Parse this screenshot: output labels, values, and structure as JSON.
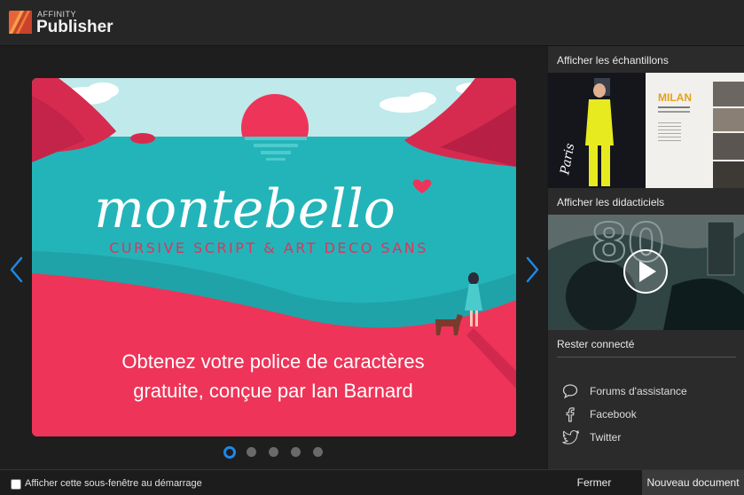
{
  "app": {
    "brand_small": "AFFINITY",
    "brand_name": "Publisher"
  },
  "carousel": {
    "headline": "montebello",
    "subheadline": "CURSIVE SCRIPT & ART DECO SANS",
    "caption_line1": "Obtenez votre police de caractères",
    "caption_line2": "gratuite, conçue par Ian Barnard",
    "page_count": 5,
    "active_page": 1
  },
  "sidebar": {
    "samples_title": "Afficher les échantillons",
    "sample_thumb_text": {
      "city": "MILAN",
      "script": "Paris"
    },
    "tutorials_title": "Afficher les didacticiels",
    "connect_title": "Rester connecté",
    "links": [
      {
        "label": "Forums d'assistance",
        "icon": "chat-bubble-icon"
      },
      {
        "label": "Facebook",
        "icon": "facebook-icon"
      },
      {
        "label": "Twitter",
        "icon": "twitter-icon"
      }
    ]
  },
  "footer": {
    "startup_checkbox_label": "Afficher cette sous-fenêtre au démarrage",
    "startup_checked": false,
    "close_button": "Fermer",
    "new_document_button": "Nouveau document"
  },
  "colors": {
    "accent": "#1e88e5",
    "poster_red": "#ee3458",
    "poster_teal": "#23b4b9",
    "logo_orange": "#e9633a"
  }
}
